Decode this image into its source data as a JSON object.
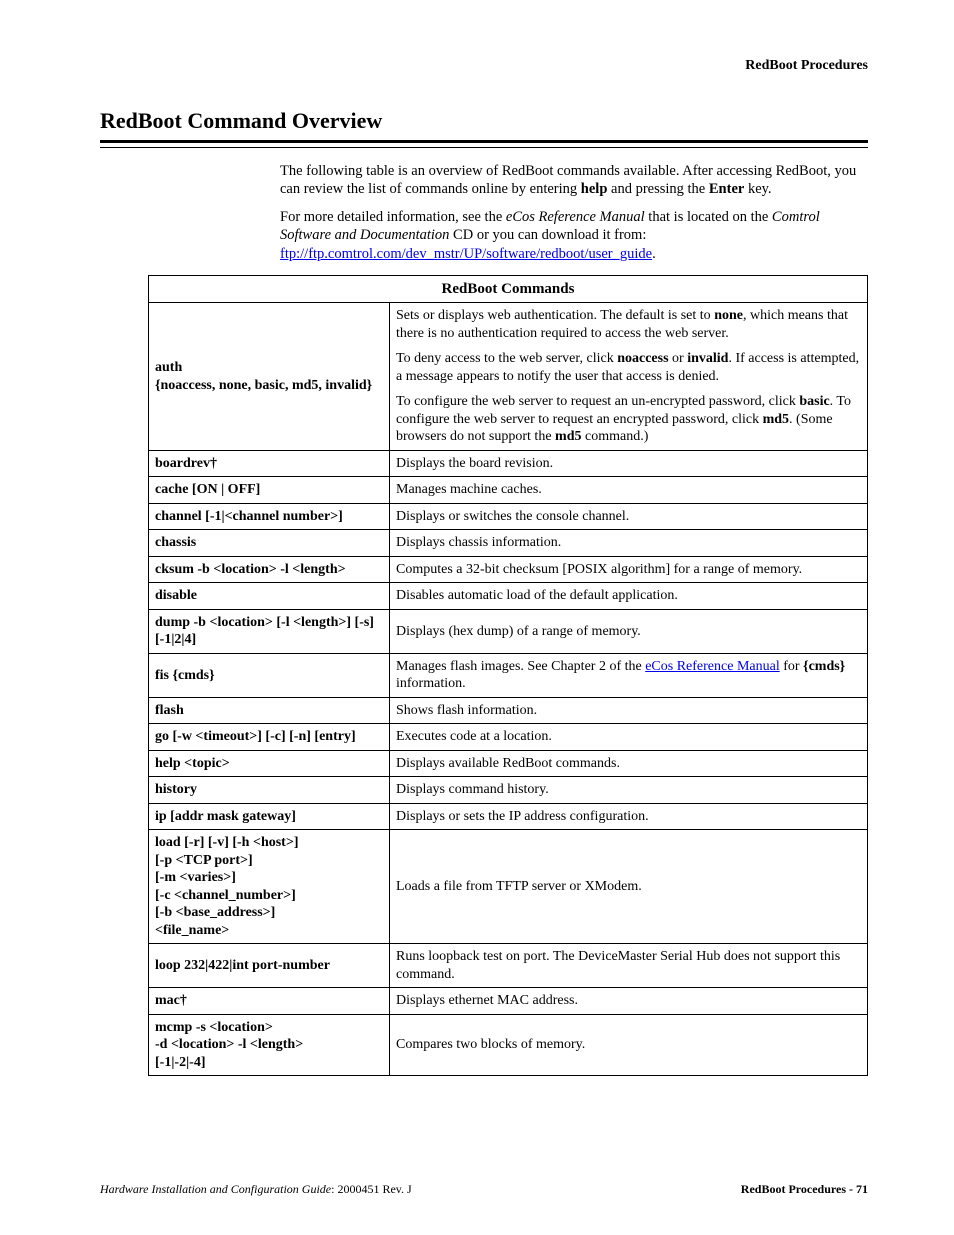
{
  "header": {
    "running": "RedBoot Procedures"
  },
  "title": "RedBoot Command Overview",
  "intro": {
    "p1a": "The following table is an overview of RedBoot commands available. After accessing RedBoot, you can review the list of commands online by entering ",
    "p1b": "help",
    "p1c": " and pressing the ",
    "p1d": "Enter",
    "p1e": " key.",
    "p2a": "For more detailed information, see the ",
    "p2b": "eCos Reference Manual",
    "p2c": " that is located on the ",
    "p2d": "Comtrol Software and Documentation",
    "p2e": " CD or you can download it from: ",
    "p2link": "ftp://ftp.comtrol.com/dev_mstr/UP/software/redboot/user_guide",
    "p2f": "."
  },
  "table_title": "RedBoot Commands",
  "rows": {
    "r0cmd1": "auth",
    "r0cmd2": "{noaccess, none, basic, md5, invalid}",
    "r0d1a": "Sets or displays web authentication. The default is set to ",
    "r0d1b": "none",
    "r0d1c": ", which means that there is no authentication required to access the web server.",
    "r0d2a": "To deny access to the web server, click ",
    "r0d2b": "noaccess",
    "r0d2c": " or ",
    "r0d2d": "invalid",
    "r0d2e": ". If access is attempted, a message appears to notify the user that access is denied.",
    "r0d3a": "To configure the web server to request an un-encrypted password, click ",
    "r0d3b": "basic",
    "r0d3c": ". To configure the web server to request an encrypted password, click ",
    "r0d3d": "md5",
    "r0d3e": ". (Some browsers do not support the ",
    "r0d3f": "md5",
    "r0d3g": " command.)",
    "r1cmd": "boardrev†",
    "r1desc": "Displays the board revision.",
    "r2cmd": "cache [ON | OFF]",
    "r2desc": "Manages machine caches.",
    "r3cmd": "channel [-1|<channel number>]",
    "r3desc": "Displays or switches the console channel.",
    "r4cmd": "chassis",
    "r4desc": "Displays chassis information.",
    "r5cmd": "cksum -b <location> -l <length>",
    "r5desc": "Computes a 32-bit checksum [POSIX algorithm] for a range of memory.",
    "r6cmd": "disable",
    "r6desc": "Disables automatic load of the default application.",
    "r7cmd": "dump -b <location> [-l <length>] [-s] [-1|2|4]",
    "r7desc": "Displays (hex dump) of a range of memory.",
    "r8cmd": "fis {cmds}",
    "r8desca": "Manages flash images. See Chapter 2 of the ",
    "r8link": "eCos Reference Manual",
    "r8descb": " for ",
    "r8descc": "{cmds}",
    "r8descd": " information.",
    "r9cmd": "flash",
    "r9desc": "Shows flash information.",
    "r10cmd": "go [-w <timeout>] [-c] [-n] [entry]",
    "r10desc": "Executes code at a location.",
    "r11cmd": "help <topic>",
    "r11desc": "Displays available RedBoot commands.",
    "r12cmd": "history",
    "r12desc": "Displays command history.",
    "r13cmd": "ip [addr mask gateway]",
    "r13desc": "Displays or sets the IP address configuration.",
    "r14cmd": "load [-r] [-v] [-h <host>]\n[-p <TCP port>]\n[-m <varies>]\n[-c <channel_number>]\n[-b <base_address>]\n<file_name>",
    "r14desc": "Loads a file from TFTP server or XModem.",
    "r15cmd": "loop 232|422|int port-number",
    "r15desc": "Runs loopback test on port. The DeviceMaster Serial Hub does not support this command.",
    "r16cmd": "mac†",
    "r16desc": "Displays ethernet MAC address.",
    "r17cmd": "mcmp -s <location>\n-d <location> -l <length>\n[-1|-2|-4]",
    "r17desc": "Compares two blocks of memory."
  },
  "footer": {
    "left_italic": "Hardware Installation and Configuration Guide",
    "left_rest": ": 2000451 Rev. J",
    "right": "RedBoot Procedures - 71"
  }
}
